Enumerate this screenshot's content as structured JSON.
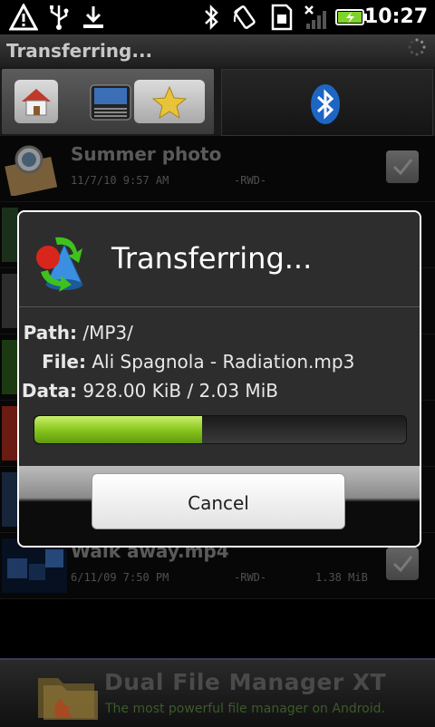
{
  "status_bar": {
    "time": "10:27",
    "icons": [
      "warning-icon",
      "usb-icon",
      "download-icon",
      "bluetooth-icon",
      "rotate-icon",
      "sim-icon",
      "no-signal-icon",
      "battery-charging-icon"
    ]
  },
  "app": {
    "title": "Transferring..."
  },
  "toolbar": {
    "left_buttons": [
      "home-icon",
      "device-icon",
      "favorite-star-icon"
    ],
    "right_icon": "bluetooth-icon"
  },
  "files": [
    {
      "name": "Summer photo",
      "date": "11/7/10 9:57 AM",
      "perm": "-RWD-",
      "size": ""
    },
    {
      "name": "Walk away.mp4",
      "date": "6/11/09 7:50 PM",
      "perm": "-RWD-",
      "size": "1.38 MiB"
    }
  ],
  "dialog": {
    "title": "Transferring...",
    "path_label": "Path:",
    "path_value": "/MP3/",
    "file_label": "File:",
    "file_value": "Ali Spagnola - Radiation.mp3",
    "data_label": "Data:",
    "data_value": "928.00 KiB / 2.03 MiB",
    "progress": 0.45,
    "cancel_label": "Cancel"
  },
  "ad": {
    "title": "Dual File Manager XT",
    "subtitle": "The most powerful file manager on Android."
  },
  "colors": {
    "progress": "#84c21b",
    "dialog_bg": "#2d2d2d",
    "battery": "#7fd32a"
  }
}
